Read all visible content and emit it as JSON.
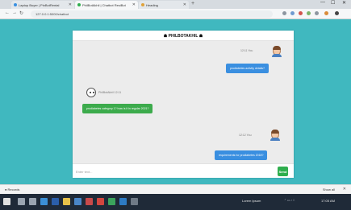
{
  "browser": {
    "tabs": [
      {
        "label": "Laptop Buyer | PinBotRental"
      },
      {
        "label": "PhilBotAkhil | Chatbot ResiBot"
      },
      {
        "label": "Heading"
      }
    ],
    "newtab_glyph": "+",
    "window_controls": [
      "—",
      "☐",
      "✕"
    ],
    "url": "127.0.0.1:5000/chatbot"
  },
  "chat": {
    "title": "☗ PHILBOTAKHIL ☗",
    "messages": [
      {
        "sender": "user",
        "meta": "12:11 You",
        "text": "prodiabetes activity details?"
      },
      {
        "sender": "bot",
        "meta": "PhilBotAkhil 12:11",
        "text": "prodiabetes category 1? how is it in regular 2021?"
      },
      {
        "sender": "user",
        "meta": "12:12 You",
        "text": "requirements for prodiabetes 2018?"
      }
    ],
    "input_placeholder": "Enter text...",
    "send_label": "Send"
  },
  "statusbar": {
    "download_label": "● Records",
    "show_all": "Show all",
    "close_glyph": "✕"
  },
  "taskbar": {
    "icons": [
      {
        "name": "windows-icon",
        "color": "#e0e0e0"
      },
      {
        "name": "search-icon",
        "color": "#9aa4b0"
      },
      {
        "name": "task-view-icon",
        "color": "#9aa4b0"
      },
      {
        "name": "edge-icon",
        "color": "#3b8fd6"
      },
      {
        "name": "word-icon",
        "color": "#2b5ea9"
      },
      {
        "name": "folder-icon",
        "color": "#e7c14a"
      },
      {
        "name": "mail-icon",
        "color": "#4a86c8"
      },
      {
        "name": "store-icon",
        "color": "#c84a4a"
      },
      {
        "name": "chrome-icon",
        "color": "#d2463f"
      },
      {
        "name": "app-icon",
        "color": "#3ba35c"
      },
      {
        "name": "code-icon",
        "color": "#2d7bc4"
      },
      {
        "name": "terminal-icon",
        "color": "#6f7a86"
      }
    ],
    "tray_left": "Lorem Ipsum",
    "clock": "17:05 AM"
  }
}
